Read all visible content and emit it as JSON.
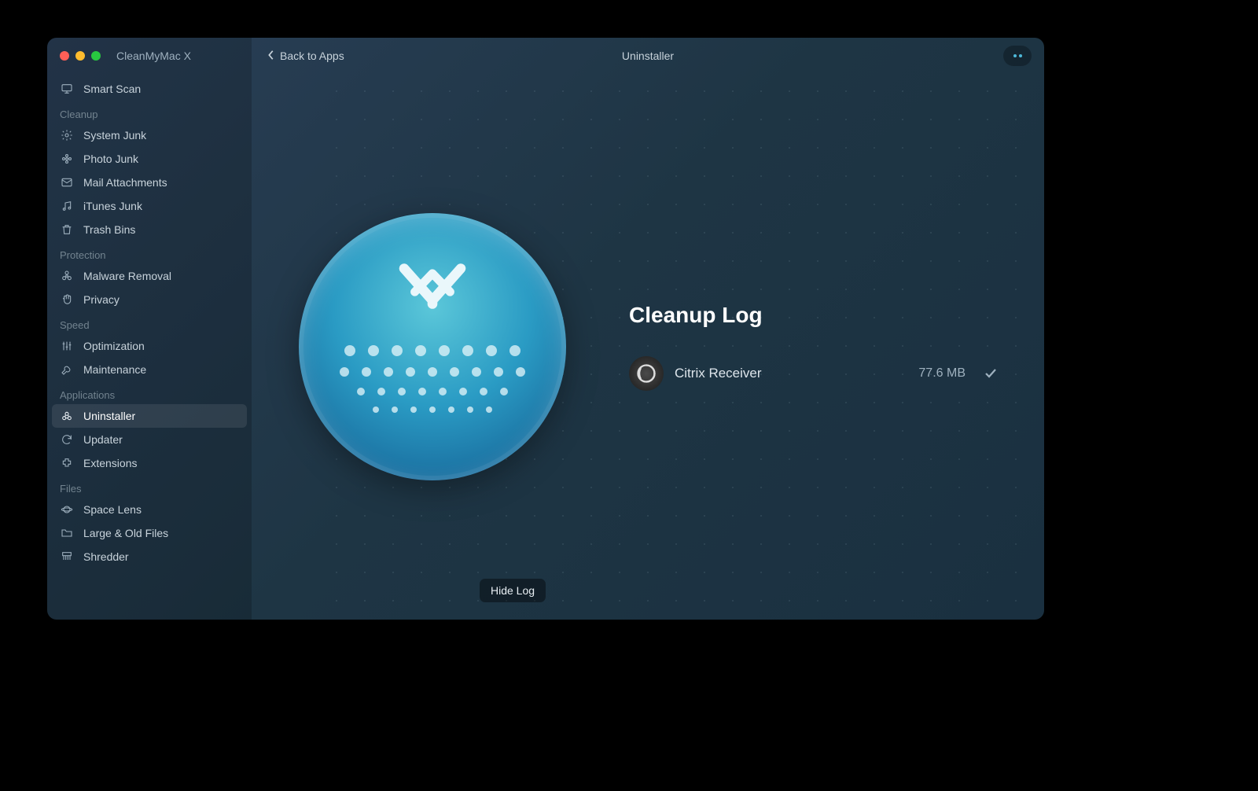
{
  "app_title": "CleanMyMac X",
  "header": {
    "back_label": "Back to Apps",
    "center_title": "Uninstaller"
  },
  "sidebar": {
    "smart_scan": "Smart Scan",
    "sections": {
      "cleanup": {
        "header": "Cleanup",
        "items": [
          "System Junk",
          "Photo Junk",
          "Mail Attachments",
          "iTunes Junk",
          "Trash Bins"
        ]
      },
      "protection": {
        "header": "Protection",
        "items": [
          "Malware Removal",
          "Privacy"
        ]
      },
      "speed": {
        "header": "Speed",
        "items": [
          "Optimization",
          "Maintenance"
        ]
      },
      "applications": {
        "header": "Applications",
        "items": [
          "Uninstaller",
          "Updater",
          "Extensions"
        ]
      },
      "files": {
        "header": "Files",
        "items": [
          "Space Lens",
          "Large & Old Files",
          "Shredder"
        ]
      }
    }
  },
  "log": {
    "title": "Cleanup Log",
    "entries": [
      {
        "name": "Citrix Receiver",
        "size": "77.6 MB"
      }
    ]
  },
  "hide_log_label": "Hide Log"
}
